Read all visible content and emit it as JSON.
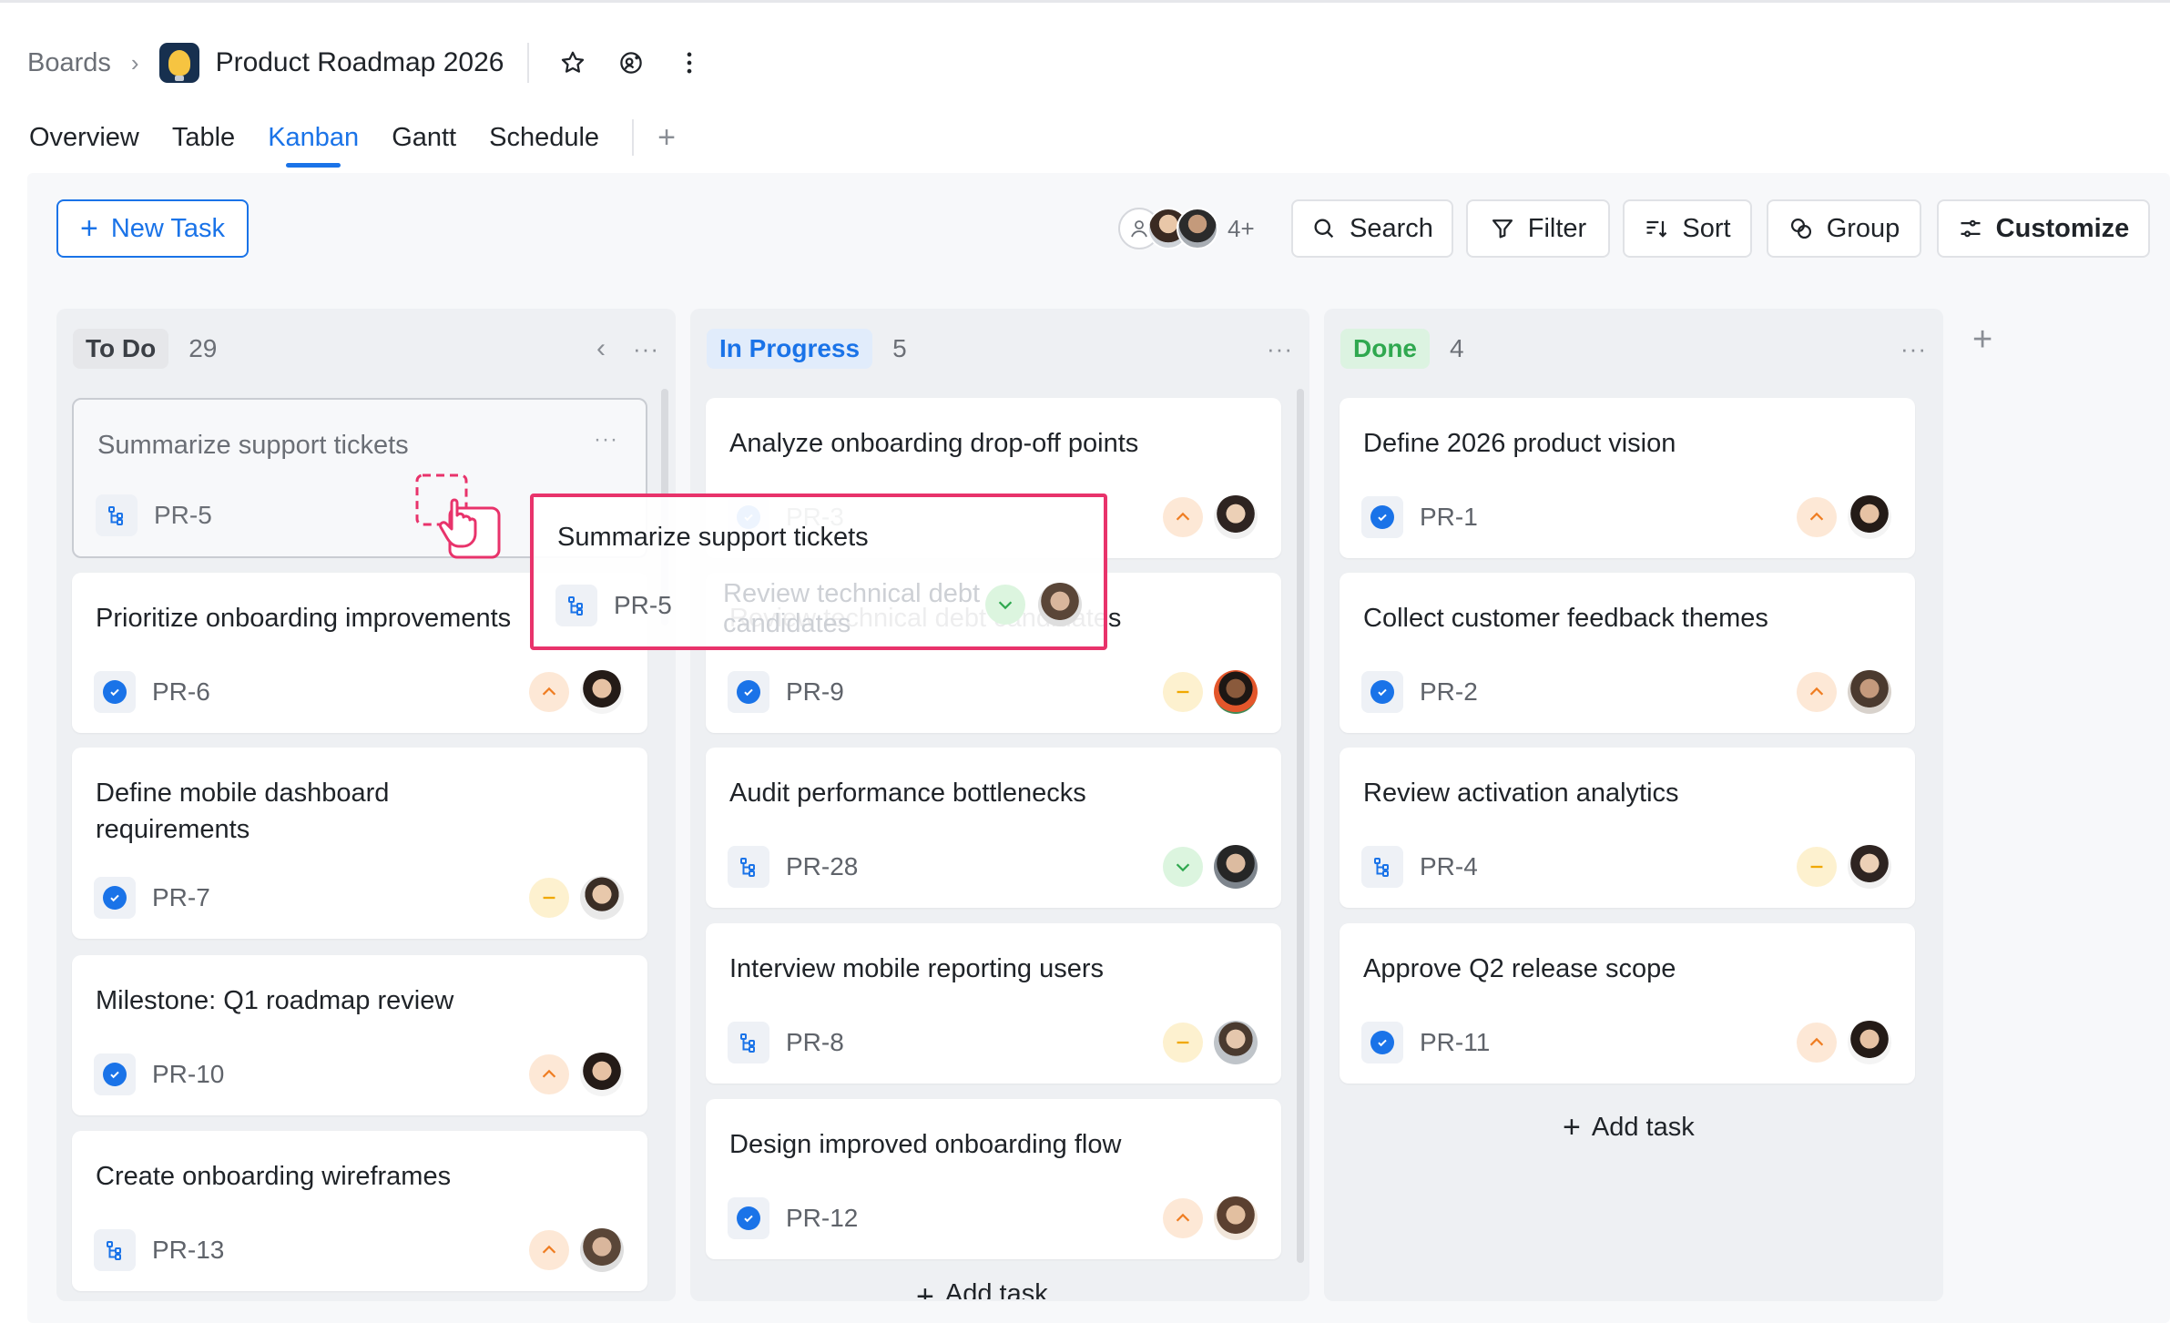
{
  "breadcrumb": {
    "root": "Boards",
    "separator": "›",
    "board_title": "Product Roadmap 2026"
  },
  "tabs": [
    {
      "label": "Overview",
      "active": false
    },
    {
      "label": "Table",
      "active": false
    },
    {
      "label": "Kanban",
      "active": true
    },
    {
      "label": "Gantt",
      "active": false
    },
    {
      "label": "Schedule",
      "active": false
    }
  ],
  "toolbar": {
    "new_task": "New Task",
    "members_more": "4+",
    "search": "Search",
    "filter": "Filter",
    "sort": "Sort",
    "group": "Group",
    "customize": "Customize"
  },
  "colors": {
    "accent": "#1a73e8",
    "drag_outline": "#e8336b",
    "todo_pill": "#e6e7ea",
    "progress_pill": "#e1ecfb",
    "done_pill": "#dcf3e1"
  },
  "columns": [
    {
      "title": "To Do",
      "count": "29",
      "cards": [
        {
          "title": "Summarize support tickets",
          "id": "PR-5",
          "type": "subtask",
          "priority": "",
          "state": "drag-placeholder"
        },
        {
          "title": "Prioritize onboarding improvements",
          "id": "PR-6",
          "type": "task",
          "priority": "high"
        },
        {
          "title": "Define mobile dashboard requirements",
          "id": "PR-7",
          "type": "task",
          "priority": "medium"
        },
        {
          "title": "Milestone: Q1 roadmap review",
          "id": "PR-10",
          "type": "task",
          "priority": "high"
        },
        {
          "title": "Create onboarding wireframes",
          "id": "PR-13",
          "type": "subtask",
          "priority": "high"
        }
      ]
    },
    {
      "title": "In Progress",
      "count": "5",
      "cards": [
        {
          "title": "Analyze onboarding drop-off points",
          "id": "PR-3",
          "type": "task",
          "priority": "high"
        },
        {
          "title": "Review technical debt candidates",
          "id": "PR-9",
          "type": "task",
          "priority": "medium"
        },
        {
          "title": "Audit performance bottlenecks",
          "id": "PR-28",
          "type": "subtask",
          "priority": "low"
        },
        {
          "title": "Interview mobile reporting users",
          "id": "PR-8",
          "type": "subtask",
          "priority": "medium"
        },
        {
          "title": "Design improved onboarding flow",
          "id": "PR-12",
          "type": "task",
          "priority": "high"
        }
      ],
      "add_task": "Add task"
    },
    {
      "title": "Done",
      "count": "4",
      "cards": [
        {
          "title": "Define 2026 product vision",
          "id": "PR-1",
          "type": "task",
          "priority": "high"
        },
        {
          "title": "Collect customer feedback themes",
          "id": "PR-2",
          "type": "task",
          "priority": "high"
        },
        {
          "title": "Review activation analytics",
          "id": "PR-4",
          "type": "subtask",
          "priority": "medium"
        },
        {
          "title": "Approve Q2 release scope",
          "id": "PR-11",
          "type": "task",
          "priority": "high"
        }
      ],
      "add_task": "Add task"
    }
  ],
  "drag_preview": {
    "title": "Summarize support tickets",
    "id": "PR-5",
    "priority": "low"
  }
}
